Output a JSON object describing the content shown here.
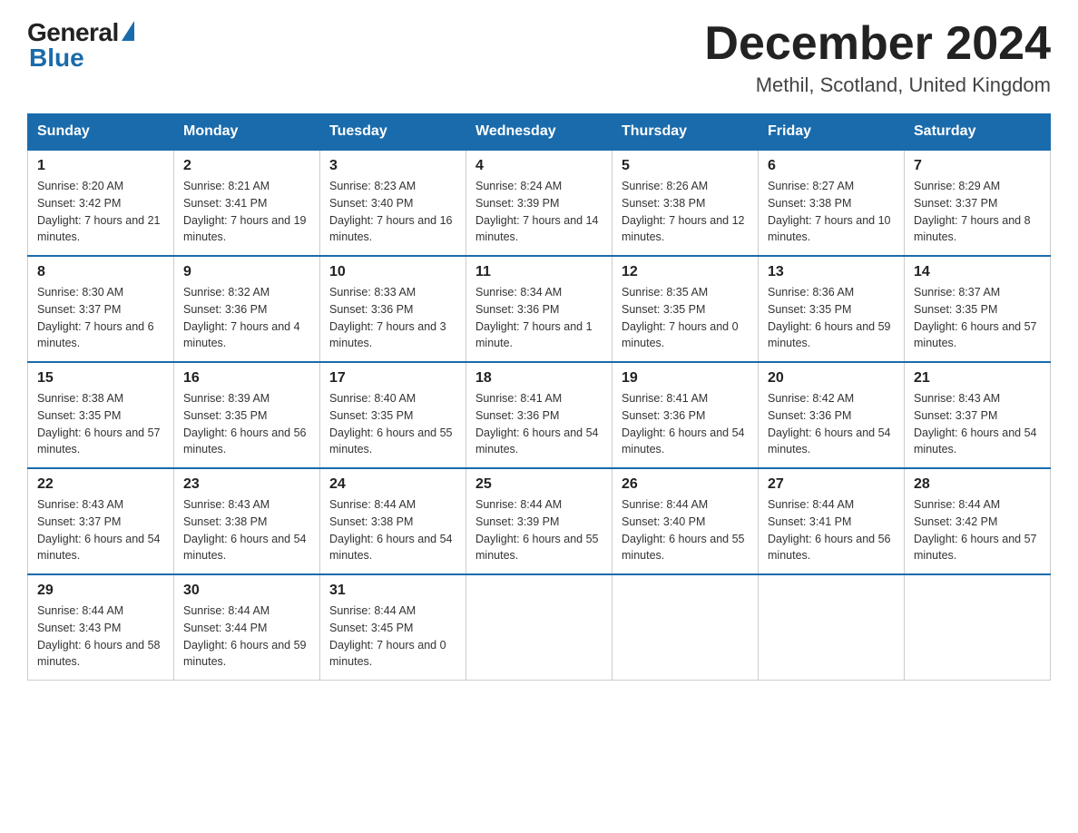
{
  "header": {
    "logo_general": "General",
    "logo_blue": "Blue",
    "title": "December 2024",
    "subtitle": "Methil, Scotland, United Kingdom"
  },
  "days_of_week": [
    "Sunday",
    "Monday",
    "Tuesday",
    "Wednesday",
    "Thursday",
    "Friday",
    "Saturday"
  ],
  "weeks": [
    [
      {
        "day": "1",
        "sunrise": "8:20 AM",
        "sunset": "3:42 PM",
        "daylight": "7 hours and 21 minutes."
      },
      {
        "day": "2",
        "sunrise": "8:21 AM",
        "sunset": "3:41 PM",
        "daylight": "7 hours and 19 minutes."
      },
      {
        "day": "3",
        "sunrise": "8:23 AM",
        "sunset": "3:40 PM",
        "daylight": "7 hours and 16 minutes."
      },
      {
        "day": "4",
        "sunrise": "8:24 AM",
        "sunset": "3:39 PM",
        "daylight": "7 hours and 14 minutes."
      },
      {
        "day": "5",
        "sunrise": "8:26 AM",
        "sunset": "3:38 PM",
        "daylight": "7 hours and 12 minutes."
      },
      {
        "day": "6",
        "sunrise": "8:27 AM",
        "sunset": "3:38 PM",
        "daylight": "7 hours and 10 minutes."
      },
      {
        "day": "7",
        "sunrise": "8:29 AM",
        "sunset": "3:37 PM",
        "daylight": "7 hours and 8 minutes."
      }
    ],
    [
      {
        "day": "8",
        "sunrise": "8:30 AM",
        "sunset": "3:37 PM",
        "daylight": "7 hours and 6 minutes."
      },
      {
        "day": "9",
        "sunrise": "8:32 AM",
        "sunset": "3:36 PM",
        "daylight": "7 hours and 4 minutes."
      },
      {
        "day": "10",
        "sunrise": "8:33 AM",
        "sunset": "3:36 PM",
        "daylight": "7 hours and 3 minutes."
      },
      {
        "day": "11",
        "sunrise": "8:34 AM",
        "sunset": "3:36 PM",
        "daylight": "7 hours and 1 minute."
      },
      {
        "day": "12",
        "sunrise": "8:35 AM",
        "sunset": "3:35 PM",
        "daylight": "7 hours and 0 minutes."
      },
      {
        "day": "13",
        "sunrise": "8:36 AM",
        "sunset": "3:35 PM",
        "daylight": "6 hours and 59 minutes."
      },
      {
        "day": "14",
        "sunrise": "8:37 AM",
        "sunset": "3:35 PM",
        "daylight": "6 hours and 57 minutes."
      }
    ],
    [
      {
        "day": "15",
        "sunrise": "8:38 AM",
        "sunset": "3:35 PM",
        "daylight": "6 hours and 57 minutes."
      },
      {
        "day": "16",
        "sunrise": "8:39 AM",
        "sunset": "3:35 PM",
        "daylight": "6 hours and 56 minutes."
      },
      {
        "day": "17",
        "sunrise": "8:40 AM",
        "sunset": "3:35 PM",
        "daylight": "6 hours and 55 minutes."
      },
      {
        "day": "18",
        "sunrise": "8:41 AM",
        "sunset": "3:36 PM",
        "daylight": "6 hours and 54 minutes."
      },
      {
        "day": "19",
        "sunrise": "8:41 AM",
        "sunset": "3:36 PM",
        "daylight": "6 hours and 54 minutes."
      },
      {
        "day": "20",
        "sunrise": "8:42 AM",
        "sunset": "3:36 PM",
        "daylight": "6 hours and 54 minutes."
      },
      {
        "day": "21",
        "sunrise": "8:43 AM",
        "sunset": "3:37 PM",
        "daylight": "6 hours and 54 minutes."
      }
    ],
    [
      {
        "day": "22",
        "sunrise": "8:43 AM",
        "sunset": "3:37 PM",
        "daylight": "6 hours and 54 minutes."
      },
      {
        "day": "23",
        "sunrise": "8:43 AM",
        "sunset": "3:38 PM",
        "daylight": "6 hours and 54 minutes."
      },
      {
        "day": "24",
        "sunrise": "8:44 AM",
        "sunset": "3:38 PM",
        "daylight": "6 hours and 54 minutes."
      },
      {
        "day": "25",
        "sunrise": "8:44 AM",
        "sunset": "3:39 PM",
        "daylight": "6 hours and 55 minutes."
      },
      {
        "day": "26",
        "sunrise": "8:44 AM",
        "sunset": "3:40 PM",
        "daylight": "6 hours and 55 minutes."
      },
      {
        "day": "27",
        "sunrise": "8:44 AM",
        "sunset": "3:41 PM",
        "daylight": "6 hours and 56 minutes."
      },
      {
        "day": "28",
        "sunrise": "8:44 AM",
        "sunset": "3:42 PM",
        "daylight": "6 hours and 57 minutes."
      }
    ],
    [
      {
        "day": "29",
        "sunrise": "8:44 AM",
        "sunset": "3:43 PM",
        "daylight": "6 hours and 58 minutes."
      },
      {
        "day": "30",
        "sunrise": "8:44 AM",
        "sunset": "3:44 PM",
        "daylight": "6 hours and 59 minutes."
      },
      {
        "day": "31",
        "sunrise": "8:44 AM",
        "sunset": "3:45 PM",
        "daylight": "7 hours and 0 minutes."
      },
      null,
      null,
      null,
      null
    ]
  ]
}
